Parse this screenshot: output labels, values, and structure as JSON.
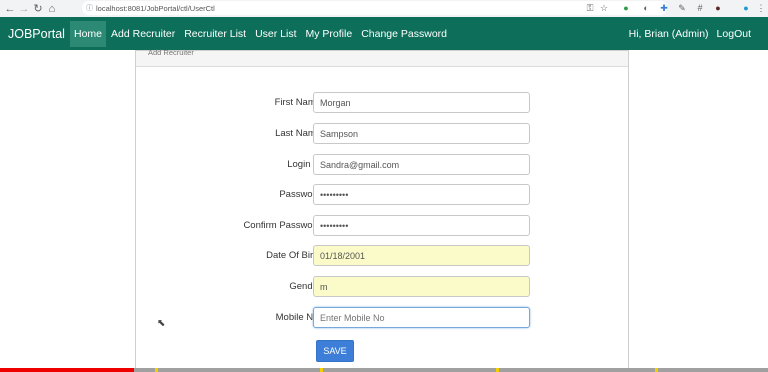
{
  "browser": {
    "url": "localhost:8081/JobPortal/ctl/UserCtl"
  },
  "navbar": {
    "brand": "JOBPortal",
    "links": [
      "Home",
      "Add Recruiter",
      "Recruiter List",
      "User List",
      "My Profile",
      "Change Password"
    ],
    "active_index": 0,
    "greeting": "Hi, Brian (Admin)",
    "logout": "LogOut",
    "color": "#0d6f5a"
  },
  "form": {
    "panel_title": "Add Recruiter",
    "fields": [
      {
        "label": "First Name",
        "value": "Morgan"
      },
      {
        "label": "Last Name",
        "value": "Sampson"
      },
      {
        "label": "Login Id",
        "value": "Sandra@gmail.com"
      },
      {
        "label": "Password",
        "value": "•••••••••"
      },
      {
        "label": "Confirm Password",
        "value": "•••••••••"
      },
      {
        "label": "Date Of Birth",
        "value": "01/18/2001"
      },
      {
        "label": "Gender",
        "value": "m"
      },
      {
        "label": "Mobile No.",
        "value": "",
        "placeholder": "Enter Mobile No"
      }
    ],
    "required_mark": "*",
    "save_label": "SAVE"
  },
  "video_progress": {
    "fraction": 0.175
  }
}
